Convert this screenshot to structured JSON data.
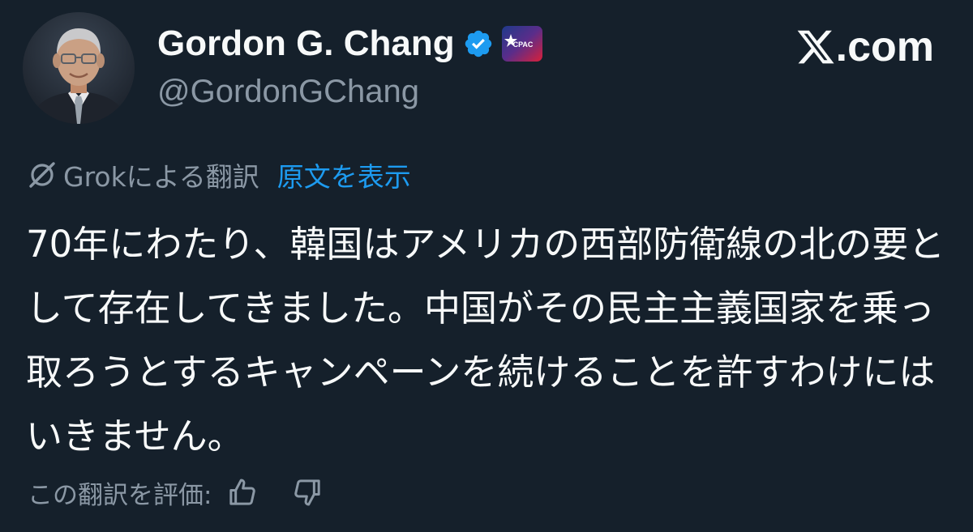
{
  "author": {
    "display_name": "Gordon G. Chang",
    "handle": "@GordonGChang",
    "verified_icon": "verified-checkmark-icon",
    "affiliate_badge": "cpac-badge-icon",
    "affiliate_badge_text": "CPAC",
    "verified_color": "#1d9bf0"
  },
  "site": {
    "logo_icon": "x-logo-icon",
    "suffix": ".com"
  },
  "translation": {
    "icon": "grok-icon",
    "label": "Grokによる翻訳",
    "show_original": "原文を表示",
    "link_color": "#1d9bf0"
  },
  "tweet": {
    "text": " 70年にわたり、韓国はアメリカの西部防衛線の北の要として存在してきました。中国がその民主主義国家を乗っ取ろうとするキャンペーンを続けることを許すわけにはいきません。"
  },
  "feedback": {
    "label": "この翻訳を評価:",
    "like_icon": "thumbs-up-icon",
    "dislike_icon": "thumbs-down-icon"
  },
  "theme": {
    "background": "#15202b",
    "text": "#f7f9f9",
    "secondary_text": "#8b98a5"
  }
}
